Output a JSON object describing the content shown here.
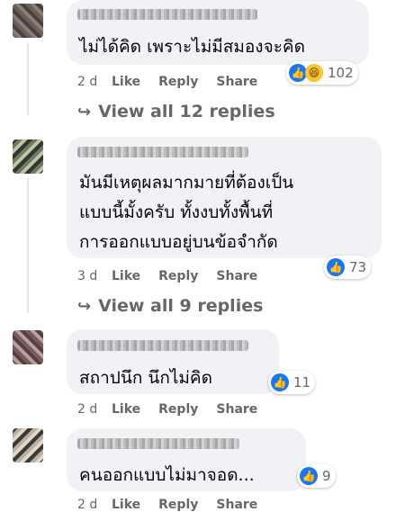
{
  "comments": [
    {
      "text_lines": [
        "ไม่ได้คิด เพราะไม่มีสมองจะคิด"
      ],
      "reactions": [
        "like",
        "haha"
      ],
      "reaction_count": "102",
      "time": "2 d",
      "like_label": "Like",
      "reply_label": "Reply",
      "share_label": "Share",
      "view_replies": "View all 12 replies"
    },
    {
      "text_lines": [
        "มันมีเหตุผลมากมายที่ต้องเป็น",
        "แบบนี้มั้งครับ ทั้งงบทั้งพื้นที่",
        "การออกแบบอยู่บนข้อจำกัด"
      ],
      "reactions": [
        "like"
      ],
      "reaction_count": "73",
      "time": "3 d",
      "like_label": "Like",
      "reply_label": "Reply",
      "share_label": "Share",
      "view_replies": "View all 9 replies"
    },
    {
      "text_lines": [
        "สถาปนึก นึกไม่คิด"
      ],
      "reactions": [
        "like"
      ],
      "reaction_count": "11",
      "time": "2 d",
      "like_label": "Like",
      "reply_label": "Reply",
      "share_label": "Share"
    },
    {
      "text_lines": [
        "คนออกแบบไม่มาจอด..."
      ],
      "reactions": [
        "like"
      ],
      "reaction_count": "9",
      "time": "2 d",
      "like_label": "Like",
      "reply_label": "Reply",
      "share_label": "Share"
    }
  ],
  "icons": {
    "like": "thumbs-up-icon",
    "haha": "laughing-face-icon",
    "reply_arrow": "reply-arrow-icon"
  },
  "colors": {
    "like_blue": "#1877f2",
    "bubble": "#f0f2f5",
    "meta": "#65676b"
  }
}
